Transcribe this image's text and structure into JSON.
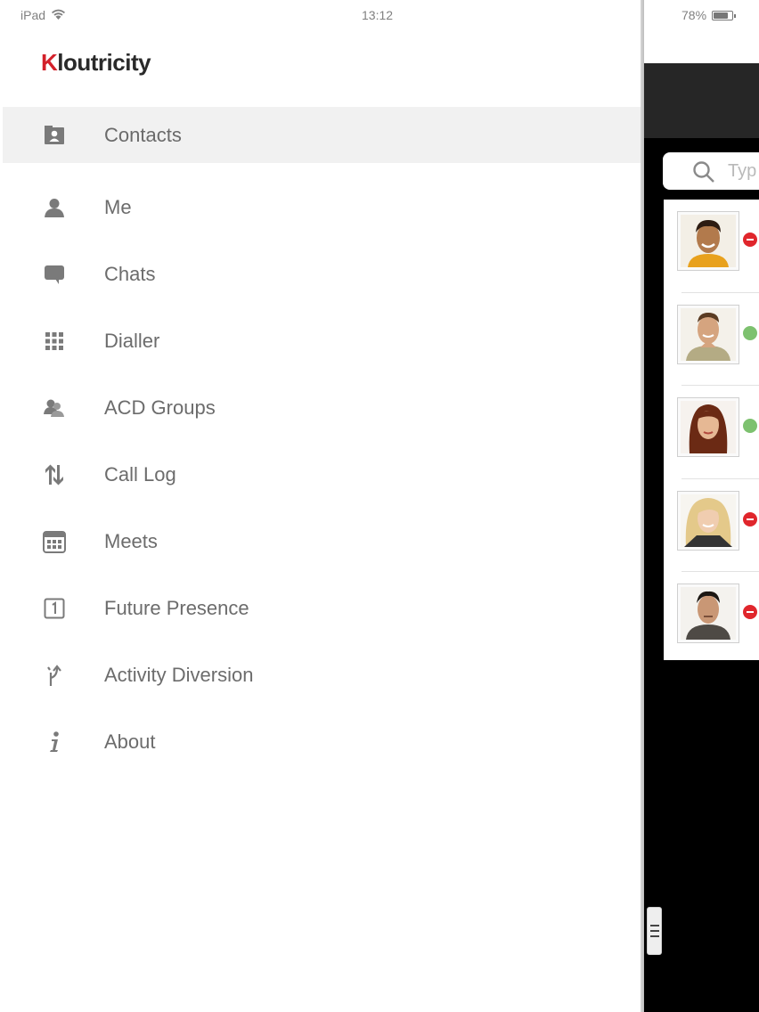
{
  "status_bar": {
    "device": "iPad",
    "time": "13:12",
    "battery": "78%",
    "battery_level": 0.78,
    "icons": [
      "wifi-icon",
      "battery-icon"
    ]
  },
  "app": {
    "logo_text_accent": "K",
    "logo_text_rest": "loutricity",
    "colors": {
      "brand_red": "#d3202a",
      "menu_text": "#6c6c6c",
      "active_row": "#f1f1f1",
      "available": "#7dc16f",
      "busy": "#e0262c"
    }
  },
  "menu": {
    "items": [
      {
        "label": "Contacts",
        "icon": "contacts-icon",
        "active": true
      },
      {
        "label": "Me",
        "icon": "person-icon"
      },
      {
        "label": "Chats",
        "icon": "chat-bubble-icon"
      },
      {
        "label": "Dialler",
        "icon": "keypad-icon"
      },
      {
        "label": "ACD Groups",
        "icon": "group-icon"
      },
      {
        "label": "Call Log",
        "icon": "up-down-arrows-icon"
      },
      {
        "label": "Meets",
        "icon": "calendar-grid-icon"
      },
      {
        "label": "Future Presence",
        "icon": "calendar-day-icon"
      },
      {
        "label": "Activity Diversion",
        "icon": "diversion-arrow-icon"
      },
      {
        "label": "About",
        "icon": "info-icon"
      }
    ]
  },
  "contacts": {
    "search_placeholder": "Typ",
    "rows": [
      {
        "avatar": "avatar-photo-man-1",
        "status": "busy"
      },
      {
        "avatar": "avatar-photo-man-2",
        "status": "available"
      },
      {
        "avatar": "avatar-photo-woman-1",
        "status": "available"
      },
      {
        "avatar": "avatar-photo-woman-2",
        "status": "busy"
      },
      {
        "avatar": "avatar-photo-man-3",
        "status": "busy"
      }
    ]
  }
}
